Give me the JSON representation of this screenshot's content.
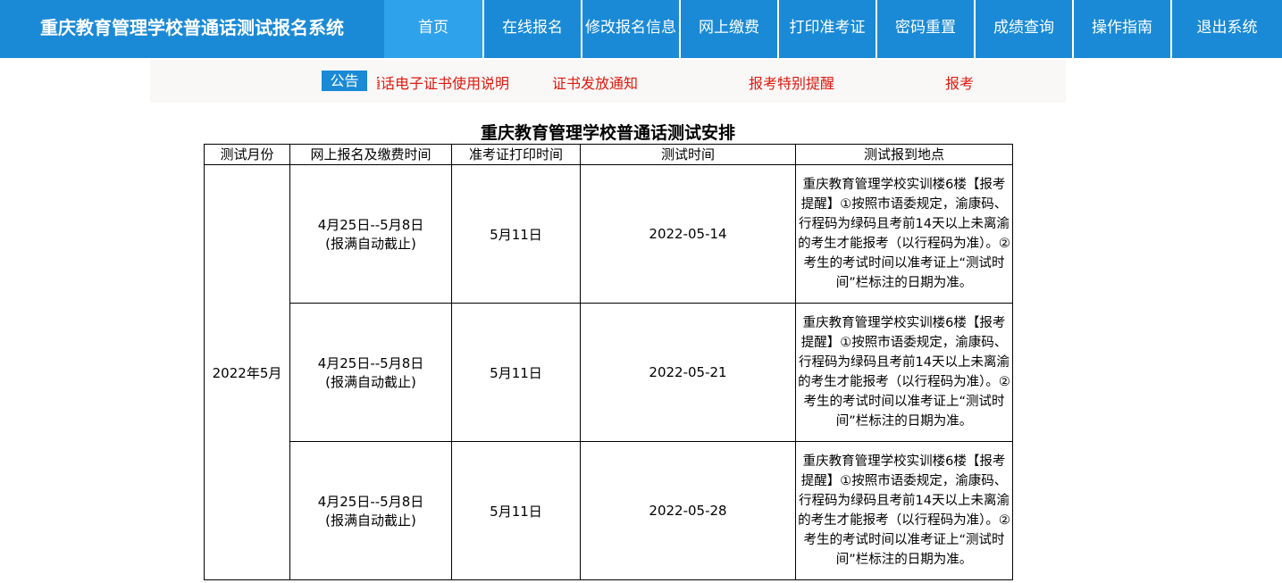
{
  "header": {
    "brand": "重庆教育管理学校普通话测试报名系统",
    "nav": [
      {
        "label": "首页",
        "active": true
      },
      {
        "label": "在线报名"
      },
      {
        "label": "修改报名信息"
      },
      {
        "label": "网上缴费"
      },
      {
        "label": "打印准考证"
      },
      {
        "label": "密码重置"
      },
      {
        "label": "成绩查询"
      },
      {
        "label": "操作指南"
      },
      {
        "label": "退出系统"
      }
    ]
  },
  "notice": {
    "badge": "公告",
    "items": [
      "普通话电子证书使用说明",
      "证书发放通知",
      "报考特别提醒",
      "报考"
    ]
  },
  "schedule": {
    "title": "重庆教育管理学校普通话测试安排",
    "columns": [
      "测试月份",
      "网上报名及缴费时间",
      "准考证打印时间",
      "测试时间",
      "测试报到地点"
    ],
    "month": "2022年5月",
    "rows": [
      {
        "reg_line1": "4月25日--5月8日",
        "reg_line2": "(报满自动截止)",
        "print": "5月11日",
        "test_date": "2022-05-14",
        "location": "重庆教育管理学校实训楼6楼【报考提醒】①按照市语委规定，渝康码、行程码为绿码且考前14天以上未离渝的考生才能报考（以行程码为准）。②考生的考试时间以准考证上“测试时间”栏标注的日期为准。"
      },
      {
        "reg_line1": "4月25日--5月8日",
        "reg_line2": "(报满自动截止)",
        "print": "5月11日",
        "test_date": "2022-05-21",
        "location": "重庆教育管理学校实训楼6楼【报考提醒】①按照市语委规定，渝康码、行程码为绿码且考前14天以上未离渝的考生才能报考（以行程码为准）。②考生的考试时间以准考证上“测试时间”栏标注的日期为准。"
      },
      {
        "reg_line1": "4月25日--5月8日",
        "reg_line2": "(报满自动截止)",
        "print": "5月11日",
        "test_date": "2022-05-28",
        "location": "重庆教育管理学校实训楼6楼【报考提醒】①按照市语委规定，渝康码、行程码为绿码且考前14天以上未离渝的考生才能报考（以行程码为准）。②考生的考试时间以准考证上“测试时间”栏标注的日期为准。"
      }
    ]
  }
}
